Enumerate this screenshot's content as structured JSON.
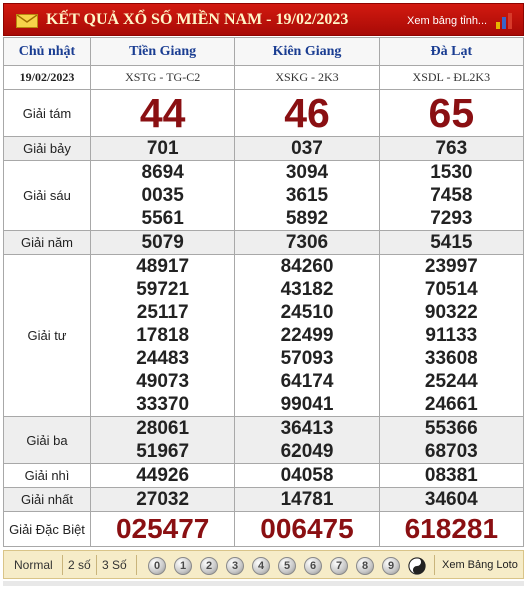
{
  "header": {
    "title": "KẾT QUẢ XỔ SỐ MIỀN NAM - 19/02/2023",
    "view_link": "Xem bảng tỉnh...",
    "mail_icon": "mail-icon",
    "chart_icon": "bar-chart-icon",
    "colors": {
      "bar": "#c8140c",
      "title": "#fff6c8"
    }
  },
  "columns": {
    "day": "Chủ nhật",
    "date": "19/02/2023",
    "provinces": [
      {
        "name": "Tiền Giang",
        "code": "XSTG - TG-C2"
      },
      {
        "name": "Kiên Giang",
        "code": "XSKG - 2K3"
      },
      {
        "name": "Đà Lạt",
        "code": "XSDL - ĐL2K3"
      }
    ]
  },
  "prizes": {
    "g8": {
      "label": "Giải tám",
      "values": [
        "44",
        "46",
        "65"
      ]
    },
    "g7": {
      "label": "Giải bảy",
      "values": [
        "701",
        "037",
        "763"
      ]
    },
    "g6": {
      "label": "Giải sáu",
      "values": [
        [
          "8694",
          "0035",
          "5561"
        ],
        [
          "3094",
          "3615",
          "5892"
        ],
        [
          "1530",
          "7458",
          "7293"
        ]
      ]
    },
    "g5": {
      "label": "Giải năm",
      "values": [
        "5079",
        "7306",
        "5415"
      ]
    },
    "g4": {
      "label": "Giải tư",
      "values": [
        [
          "48917",
          "59721",
          "25117",
          "17818",
          "24483",
          "49073",
          "33370"
        ],
        [
          "84260",
          "43182",
          "24510",
          "22499",
          "57093",
          "64174",
          "99041"
        ],
        [
          "23997",
          "70514",
          "90322",
          "91133",
          "33608",
          "25244",
          "24661"
        ]
      ]
    },
    "g3": {
      "label": "Giải ba",
      "values": [
        [
          "28061",
          "51967"
        ],
        [
          "36413",
          "62049"
        ],
        [
          "55366",
          "68703"
        ]
      ]
    },
    "g2": {
      "label": "Giải nhì",
      "values": [
        "44926",
        "04058",
        "08381"
      ]
    },
    "g1": {
      "label": "Giải nhất",
      "values": [
        "27032",
        "14781",
        "34604"
      ]
    },
    "db": {
      "label": "Giải Đặc Biệt",
      "values": [
        "025477",
        "006475",
        "618281"
      ]
    }
  },
  "footer": {
    "tabs": [
      "Normal",
      "2 số",
      "3 Số"
    ],
    "digits": [
      "0",
      "1",
      "2",
      "3",
      "4",
      "5",
      "6",
      "7",
      "8",
      "9"
    ],
    "yinyang_icon": "yin-yang-icon",
    "loto_link": "Xem Bảng Loto"
  }
}
